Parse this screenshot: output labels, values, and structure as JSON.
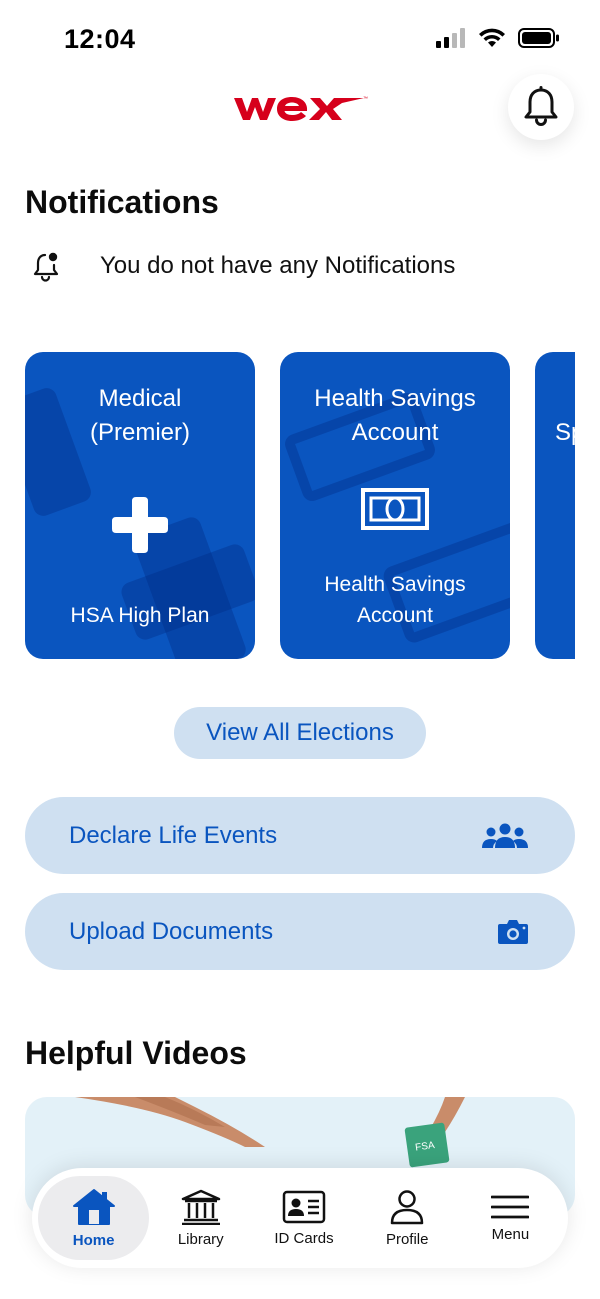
{
  "status_bar": {
    "time": "12:04"
  },
  "header": {
    "logo_text": "wex",
    "logo_icon": "wex-logo",
    "bell_icon": "bell-icon"
  },
  "notifications": {
    "title": "Notifications",
    "empty_text": "You do not have any Notifications",
    "icon": "bell-dot-icon"
  },
  "plans": [
    {
      "title_line1": "Medical",
      "title_line2": "(Premier)",
      "subtitle_line1": "HSA High Plan",
      "subtitle_line2": "",
      "icon": "medical-cross-icon"
    },
    {
      "title_line1": "Health Savings",
      "title_line2": "Account",
      "subtitle_line1": "Health Savings",
      "subtitle_line2": "Account",
      "icon": "money-bill-icon"
    },
    {
      "title_line1": "Sp",
      "title_line2": "",
      "subtitle_line1": "",
      "subtitle_line2": ""
    }
  ],
  "view_all_label": "View All Elections",
  "actions": [
    {
      "label": "Declare Life Events",
      "icon": "people-group-icon"
    },
    {
      "label": "Upload Documents",
      "icon": "camera-icon"
    }
  ],
  "videos": {
    "title": "Helpful Videos",
    "card_badge": "FSA"
  },
  "tabs": [
    {
      "label": "Home",
      "icon": "home-icon",
      "active": true
    },
    {
      "label": "Library",
      "icon": "library-icon",
      "active": false
    },
    {
      "label": "ID Cards",
      "icon": "id-card-icon",
      "active": false
    },
    {
      "label": "Profile",
      "icon": "profile-icon",
      "active": false
    },
    {
      "label": "Menu",
      "icon": "menu-icon",
      "active": false
    }
  ],
  "colors": {
    "primary_blue": "#0a55bf",
    "light_blue": "#cfe0f1",
    "brand_red": "#d6001c"
  }
}
